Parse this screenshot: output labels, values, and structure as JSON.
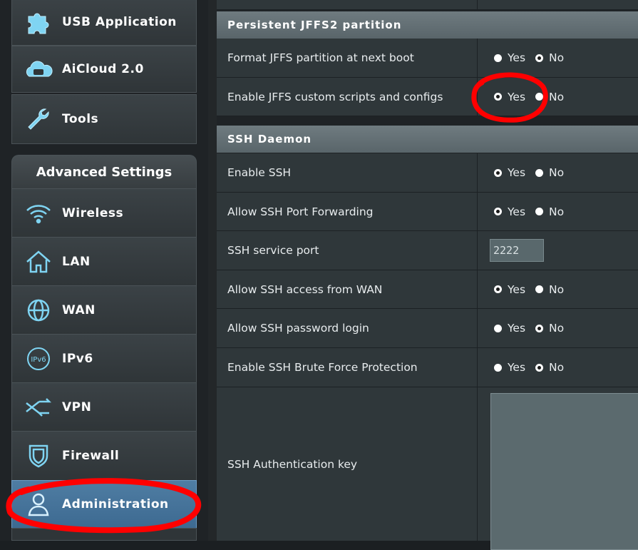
{
  "sidebar": {
    "top_items": [
      {
        "label": "USB Application",
        "icon": "puzzle-icon"
      },
      {
        "label": "AiCloud 2.0",
        "icon": "cloud-icon"
      },
      {
        "label": "Tools",
        "icon": "wrench-icon"
      }
    ],
    "advanced_header": "Advanced Settings",
    "advanced_items": [
      {
        "label": "Wireless",
        "icon": "wifi-icon"
      },
      {
        "label": "LAN",
        "icon": "home-icon"
      },
      {
        "label": "WAN",
        "icon": "globe-icon"
      },
      {
        "label": "IPv6",
        "icon": "ipv6-icon"
      },
      {
        "label": "VPN",
        "icon": "vpn-icon"
      },
      {
        "label": "Firewall",
        "icon": "shield-icon"
      },
      {
        "label": "Administration",
        "icon": "user-icon",
        "active": true
      }
    ]
  },
  "jffs": {
    "title": "Persistent JFFS2 partition",
    "rows": [
      {
        "label": "Format JFFS partition at next boot",
        "selected": "No"
      },
      {
        "label": "Enable JFFS custom scripts and configs",
        "selected": "Yes"
      }
    ]
  },
  "ssh": {
    "title": "SSH Daemon",
    "enable": {
      "label": "Enable SSH",
      "selected": "Yes"
    },
    "port_forwarding": {
      "label": "Allow SSH Port Forwarding",
      "selected": "Yes"
    },
    "port": {
      "label": "SSH service port",
      "value": "2222"
    },
    "wan_access": {
      "label": "Allow SSH access from WAN",
      "selected": "Yes"
    },
    "password_login": {
      "label": "Allow SSH password login",
      "selected": "No"
    },
    "brute_force": {
      "label": "Enable SSH Brute Force Protection",
      "selected": "No"
    },
    "auth_key": {
      "label": "SSH Authentication key",
      "value": ""
    }
  },
  "options": {
    "yes": "Yes",
    "no": "No"
  },
  "colors": {
    "annotation": "#ff0000",
    "active_menu": "#4a7aa0",
    "section_header": "#66737a"
  }
}
